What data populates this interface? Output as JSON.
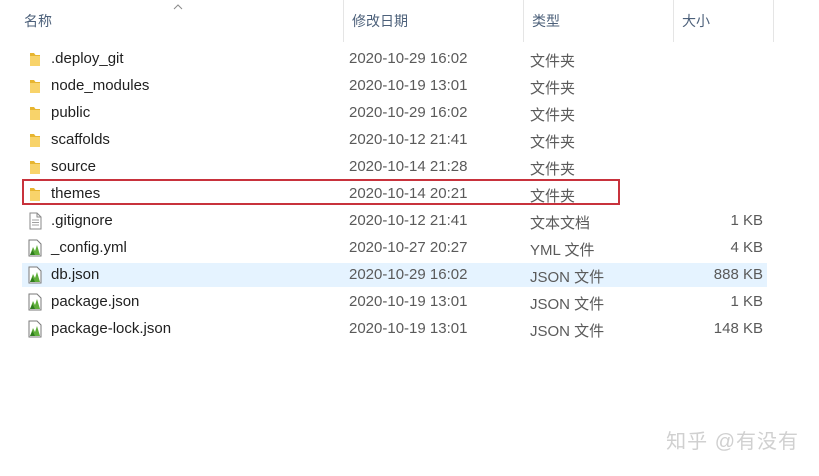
{
  "columns": {
    "name": "名称",
    "date": "修改日期",
    "type": "类型",
    "size": "大小"
  },
  "files": [
    {
      "name": ".deploy_git",
      "date": "2020-10-29 16:02",
      "type": "文件夹",
      "size": "",
      "icon": "folder-icon"
    },
    {
      "name": "node_modules",
      "date": "2020-10-19 13:01",
      "type": "文件夹",
      "size": "",
      "icon": "folder-icon"
    },
    {
      "name": "public",
      "date": "2020-10-29 16:02",
      "type": "文件夹",
      "size": "",
      "icon": "folder-icon"
    },
    {
      "name": "scaffolds",
      "date": "2020-10-12 21:41",
      "type": "文件夹",
      "size": "",
      "icon": "folder-icon"
    },
    {
      "name": "source",
      "date": "2020-10-14 21:28",
      "type": "文件夹",
      "size": "",
      "icon": "folder-icon"
    },
    {
      "name": "themes",
      "date": "2020-10-14 20:21",
      "type": "文件夹",
      "size": "",
      "icon": "folder-icon",
      "highlighted": true
    },
    {
      "name": ".gitignore",
      "date": "2020-10-12 21:41",
      "type": "文本文档",
      "size": "1 KB",
      "icon": "text-file-icon"
    },
    {
      "name": "_config.yml",
      "date": "2020-10-27 20:27",
      "type": "YML 文件",
      "size": "4 KB",
      "icon": "script-file-icon"
    },
    {
      "name": "db.json",
      "date": "2020-10-29 16:02",
      "type": "JSON 文件",
      "size": "888 KB",
      "icon": "script-file-icon",
      "hover": true
    },
    {
      "name": "package.json",
      "date": "2020-10-19 13:01",
      "type": "JSON 文件",
      "size": "1 KB",
      "icon": "script-file-icon"
    },
    {
      "name": "package-lock.json",
      "date": "2020-10-19 13:01",
      "type": "JSON 文件",
      "size": "148 KB",
      "icon": "script-file-icon"
    }
  ],
  "watermark": "知乎 @有没有",
  "colors": {
    "header_text": "#4c607a",
    "hover_row": "#e5f3ff",
    "highlight_border": "#c8323c",
    "folder": "#f5c644"
  }
}
